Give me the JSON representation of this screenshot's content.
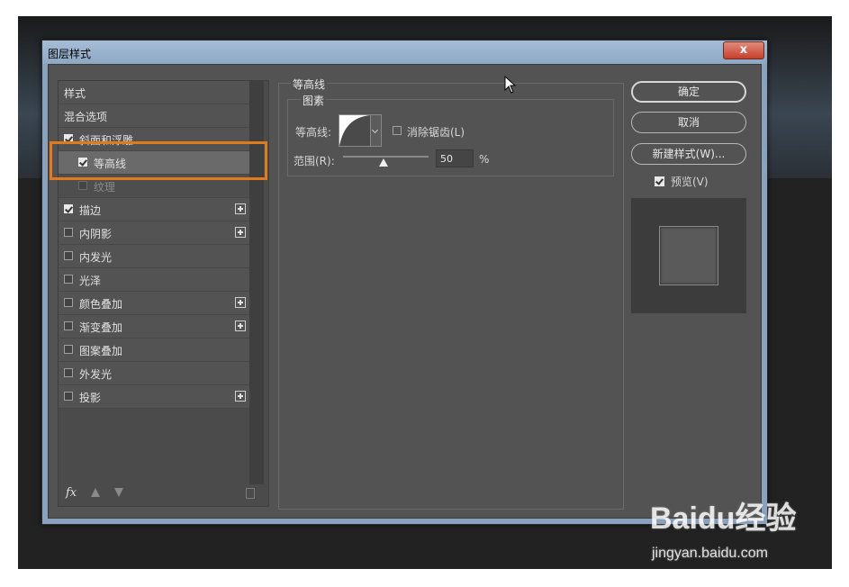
{
  "window": {
    "title": "图层样式",
    "close_symbol": "x"
  },
  "style_list": [
    {
      "label": "样式",
      "checkbox": false,
      "checked": false,
      "plus": false
    },
    {
      "label": "混合选项",
      "checkbox": false,
      "checked": false,
      "plus": false
    },
    {
      "label": "斜面和浮雕",
      "checkbox": true,
      "checked": true,
      "plus": false
    },
    {
      "label": "等高线",
      "checkbox": true,
      "checked": true,
      "plus": false,
      "selected": true
    },
    {
      "label": "纹理",
      "checkbox": true,
      "checked": false,
      "plus": false
    },
    {
      "label": "描边",
      "checkbox": true,
      "checked": true,
      "plus": true
    },
    {
      "label": "内阴影",
      "checkbox": true,
      "checked": false,
      "plus": true
    },
    {
      "label": "内发光",
      "checkbox": true,
      "checked": false,
      "plus": false
    },
    {
      "label": "光泽",
      "checkbox": true,
      "checked": false,
      "plus": false
    },
    {
      "label": "颜色叠加",
      "checkbox": true,
      "checked": false,
      "plus": true
    },
    {
      "label": "渐变叠加",
      "checkbox": true,
      "checked": false,
      "plus": true
    },
    {
      "label": "图案叠加",
      "checkbox": true,
      "checked": false,
      "plus": false
    },
    {
      "label": "外发光",
      "checkbox": true,
      "checked": false,
      "plus": false
    },
    {
      "label": "投影",
      "checkbox": true,
      "checked": false,
      "plus": true
    }
  ],
  "footer": {
    "fx_label": "fx"
  },
  "contour_panel": {
    "group_title": "等高线",
    "subgroup_title": "图素",
    "contour_label": "等高线:",
    "antialias_label": "消除锯齿(L)",
    "antialias_checked": false,
    "range_label": "范围(R):",
    "range_value": "50",
    "range_unit": "%"
  },
  "buttons": {
    "ok": "确定",
    "cancel": "取消",
    "new_style": "新建样式(W)..."
  },
  "preview": {
    "label": "预览(V)",
    "checked": true
  },
  "watermark": {
    "logo": "Baidu经验",
    "url": "jingyan.baidu.com"
  },
  "colors": {
    "highlight": "#e07a1c",
    "panel": "#535353"
  }
}
